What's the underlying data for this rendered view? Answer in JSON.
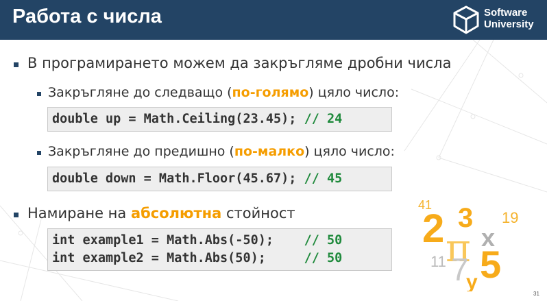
{
  "header": {
    "title": "Работа с числа",
    "logo_line1": "Software",
    "logo_line2": "University"
  },
  "bullets": {
    "b1": "В програмирането можем да закръгляме дробни числа",
    "sub1": {
      "before": "Закръгляне до следващо (",
      "highlight": "по-голямо",
      "after": ") цяло число:"
    },
    "code1": {
      "code": "double up = Math.Ceiling(23.45); ",
      "comment": "// 24"
    },
    "sub2": {
      "before": "Закръгляне до предишно (",
      "highlight": "по-малко",
      "after": ") цяло число:"
    },
    "code2": {
      "code": "double down = Math.Floor(45.67); ",
      "comment": "// 45"
    },
    "b2": {
      "before": "Намиране на ",
      "highlight": "абсолютна",
      "after": " стойност"
    },
    "code3": {
      "line1_code": "int example1 = Math.Abs(-50);    ",
      "line1_comment": "// 50",
      "line2_code": "int example2 = Math.Abs(50);     ",
      "line2_comment": "// 50"
    }
  },
  "decoration": {
    "n41": "41",
    "n2": "2",
    "n3": "3",
    "n19": "19",
    "pi": "π",
    "x": "x",
    "n11": "11",
    "n7": "7",
    "n5": "5",
    "y": "y"
  },
  "page_number": "31",
  "colors": {
    "header_bg": "#234465",
    "accent": "#f59d00",
    "comment": "#1f8a3c"
  }
}
